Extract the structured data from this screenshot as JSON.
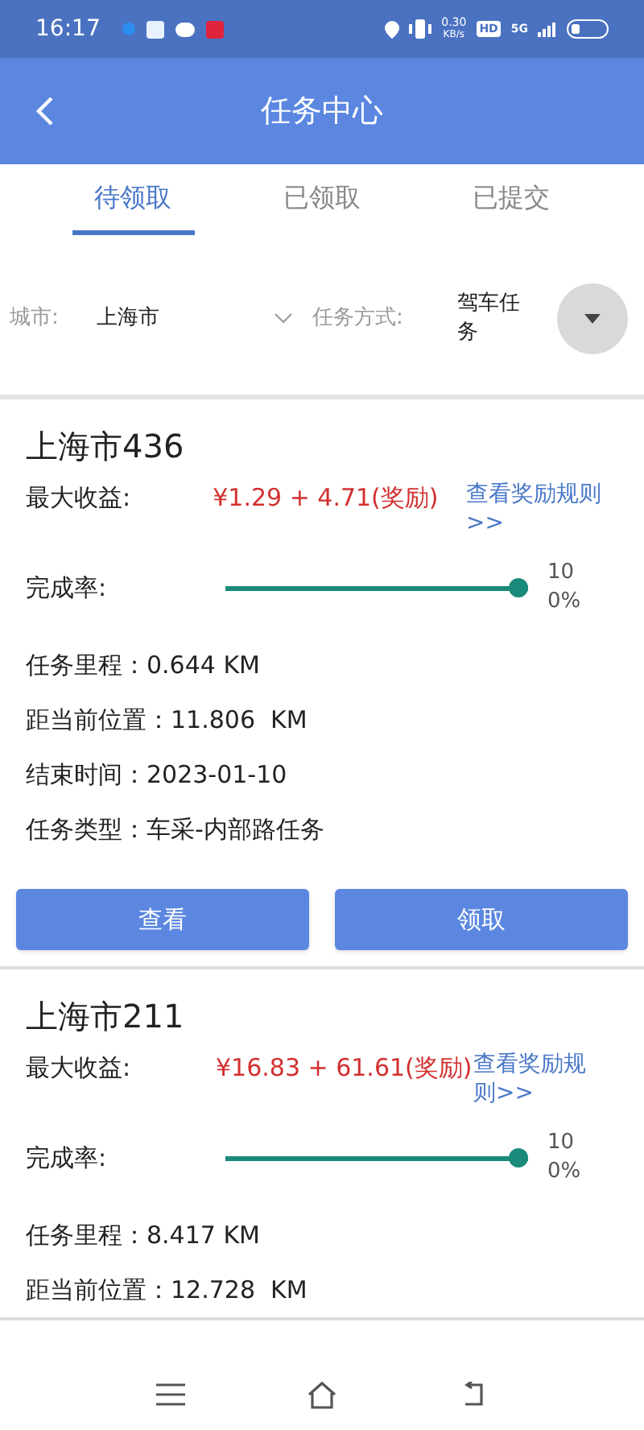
{
  "status_bar": {
    "time": "16:17",
    "net_speed": "0.30",
    "net_unit": "KB/s",
    "hd": "HD",
    "network": "5G"
  },
  "header": {
    "title": "任务中心"
  },
  "tabs": [
    {
      "label": "待领取",
      "selected": true
    },
    {
      "label": "已领取",
      "selected": false
    },
    {
      "label": "已提交",
      "selected": false
    }
  ],
  "filters": {
    "city_label": "城市:",
    "city_value": "上海市",
    "mode_label": "任务方式:",
    "mode_value": "驾车任务"
  },
  "tasks": [
    {
      "title": "上海市436",
      "reward_label": "最大收益:",
      "reward": "¥1.29 + 4.71(奖励)",
      "rules_link": "查看奖励规则>>",
      "completion_label": "完成率:",
      "level": 1,
      "completion_reading": "100%",
      "details": [
        {
          "label": "任务里程：",
          "value": "0.644 KM"
        },
        {
          "label": "距当前位置：",
          "value": "11.806  KM"
        },
        {
          "label": "结束时间：",
          "value": "2023-01-10"
        },
        {
          "label": "任务类型：",
          "value": "车采-内部路任务"
        }
      ],
      "actions": [
        "查看",
        "领取"
      ]
    },
    {
      "title": "上海市211",
      "reward_label": "最大收益:",
      "reward": "¥16.83 + 61.61(奖励)",
      "rules_link": "查看奖励规则>>",
      "completion_label": "完成率:",
      "level": 1,
      "completion_reading": "100%",
      "details": [
        {
          "label": "任务里程：",
          "value": "8.417 KM"
        },
        {
          "label": "距当前位置：",
          "value": "12.728  KM"
        }
      ]
    }
  ]
}
